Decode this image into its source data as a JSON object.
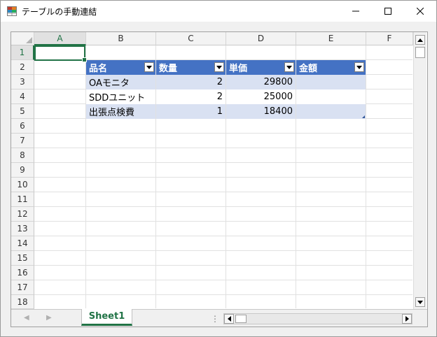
{
  "window": {
    "title": "テーブルの手動連結",
    "icon": "spreadsheet-app-icon"
  },
  "columns": [
    "A",
    "B",
    "C",
    "D",
    "E",
    "F"
  ],
  "rows": [
    "1",
    "2",
    "3",
    "4",
    "5",
    "6",
    "7",
    "8",
    "9",
    "10",
    "11",
    "12",
    "13",
    "14",
    "15",
    "16",
    "17",
    "18"
  ],
  "active_cell": "A1",
  "table": {
    "headers": [
      "品名",
      "数量",
      "単価",
      "金額"
    ],
    "rows": [
      [
        "OAモニタ",
        "2",
        "29800",
        ""
      ],
      [
        "SDDユニット",
        "2",
        "25000",
        ""
      ],
      [
        "出張点検費",
        "1",
        "18400",
        ""
      ]
    ],
    "colors": {
      "header": "#4472c4",
      "band": "#d9e1f2",
      "accent": "#217346"
    }
  },
  "sheet_tabs": [
    "Sheet1"
  ],
  "active_sheet": "Sheet1"
}
